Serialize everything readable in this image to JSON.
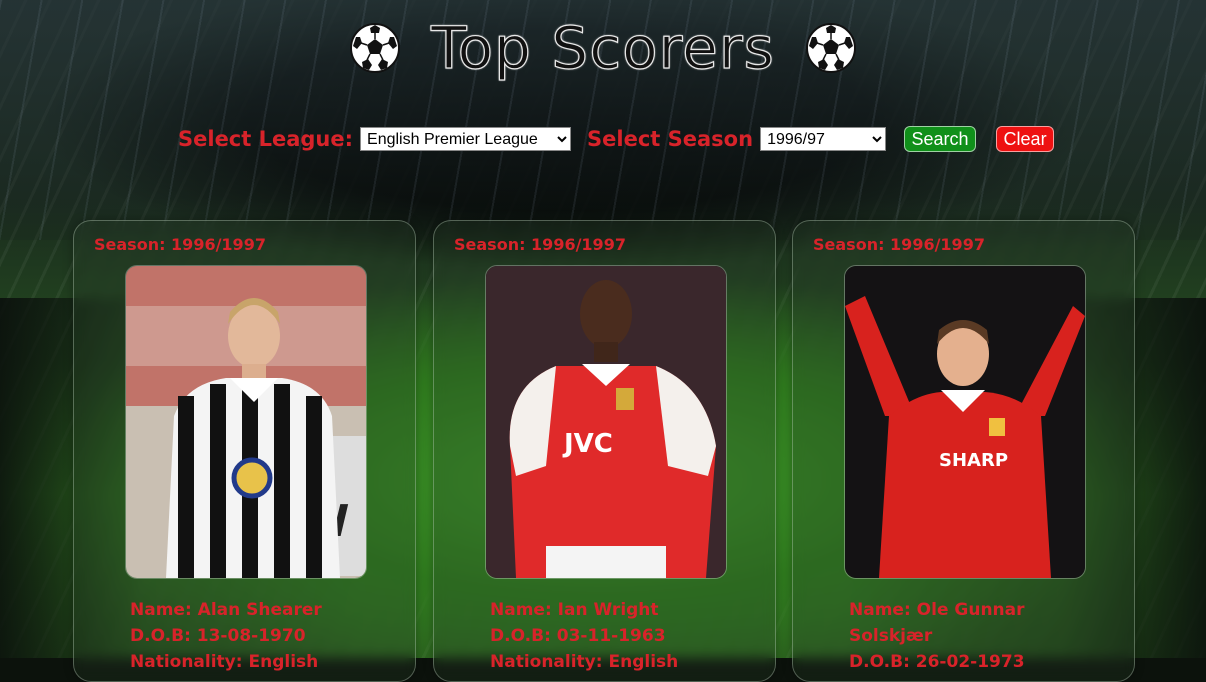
{
  "header": {
    "title": "Top Scorers",
    "left_icon": "soccer-ball-icon",
    "right_icon": "soccer-ball-icon"
  },
  "controls": {
    "league_label": "Select League:",
    "league_selected": "English Premier League",
    "season_label": "Select Season",
    "season_selected": "1996/97",
    "search_label": "Search",
    "clear_label": "Clear"
  },
  "colors": {
    "label_red": "#d8232a",
    "search_green": "#10901a",
    "clear_red": "#ee1111"
  },
  "cards": [
    {
      "season": "Season: 1996/1997",
      "name": "Name: Alan Shearer",
      "dob": "D.O.B: 13-08-1970",
      "nationality": "Nationality: English",
      "photo_kit": "black-white-stripes"
    },
    {
      "season": "Season: 1996/1997",
      "name": "Name: Ian Wright",
      "dob": "D.O.B: 03-11-1963",
      "nationality": "Nationality: English",
      "photo_kit": "red-white-jvc"
    },
    {
      "season": "Season: 1996/1997",
      "name": "Name: Ole Gunnar Solskjær",
      "dob": "D.O.B: 26-02-1973",
      "photo_kit": "red-sharp"
    }
  ]
}
